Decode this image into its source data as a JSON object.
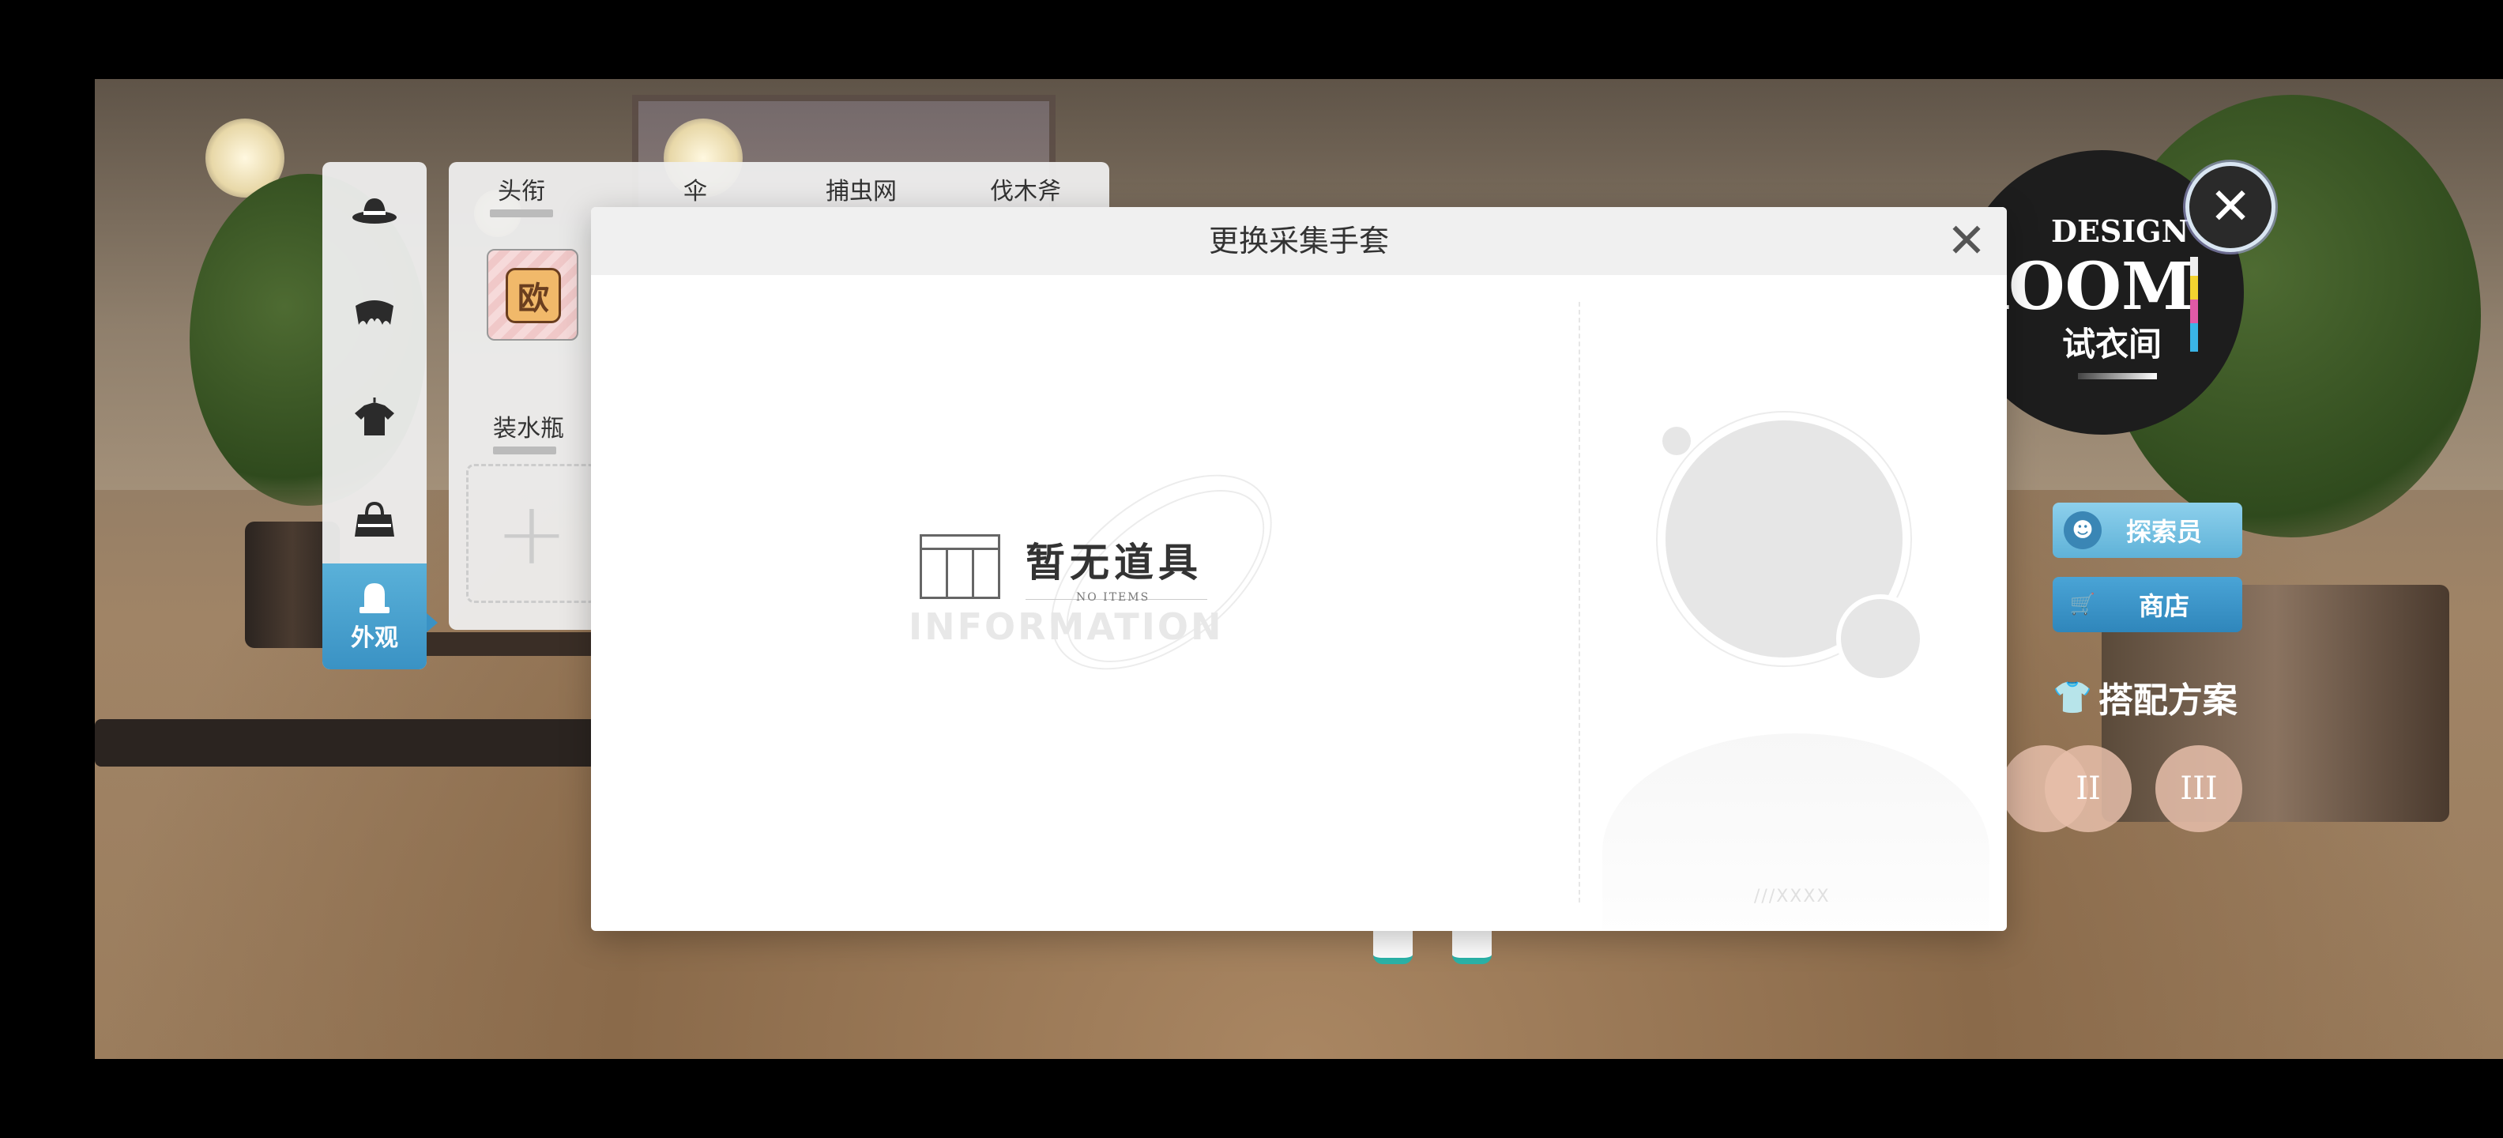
{
  "modal": {
    "title": "更换采集手套",
    "empty_zh": "暂无道具",
    "empty_en": "NO ITEMS",
    "watermark": "INFORMATION",
    "code": "///XXXX"
  },
  "sidebar": {
    "items": [
      {
        "icon": "hat-icon"
      },
      {
        "icon": "hair-icon"
      },
      {
        "icon": "shirt-icon"
      },
      {
        "icon": "bag-icon"
      },
      {
        "icon": "appearance-icon",
        "label": "外观",
        "active": true
      }
    ]
  },
  "items_panel": {
    "tabs": [
      "头衔",
      "伞",
      "捕虫网",
      "伐木斧"
    ],
    "equipped_glyph": "欧",
    "section_label": "装水瓶",
    "add_symbol": "+"
  },
  "hud": {
    "badge_line1": "DESIGN",
    "badge_line2": "ROOM",
    "badge_line3": "试衣间",
    "close_symbol": "✕",
    "explorer_label": "探索员",
    "shop_label": "商店",
    "outfit_title": "搭配方案",
    "presets": [
      "II",
      "III"
    ]
  },
  "colors": {
    "accent": "#3a92c4",
    "button": "#5fb2d8"
  }
}
